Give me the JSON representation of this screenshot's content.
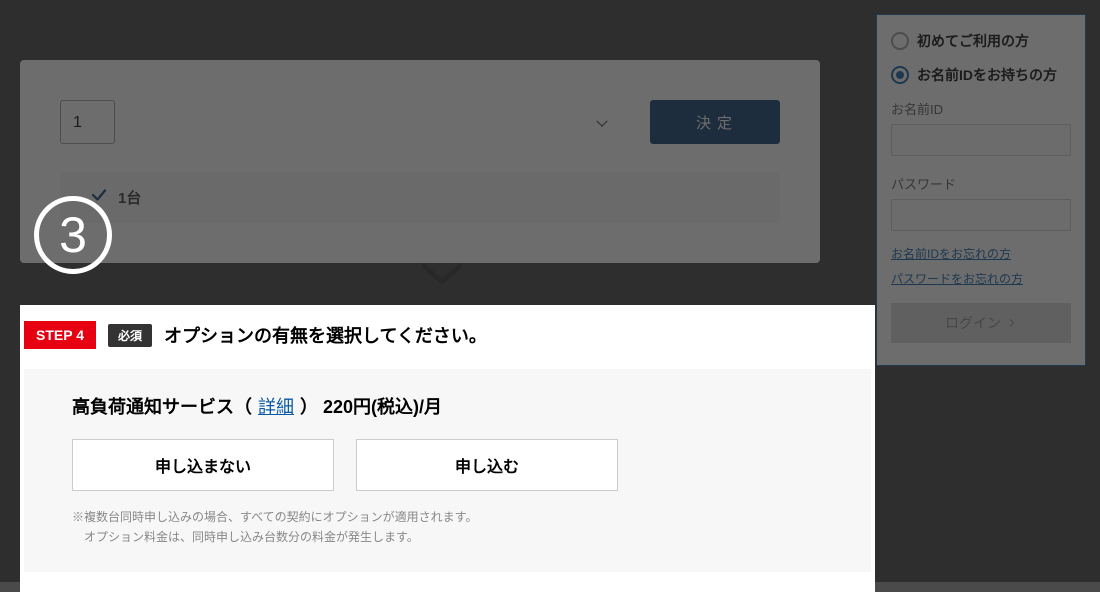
{
  "main": {
    "qty_value": "1",
    "decide_label": "決定",
    "qty_summary": "1台"
  },
  "chevron_name": "chevron-down-icon",
  "circled_num": "3",
  "login": {
    "radio_new": "初めてご利用の方",
    "radio_existing": "お名前IDをお持ちの方",
    "id_label": "お名前ID",
    "pw_label": "パスワード",
    "forgot_id": "お名前IDをお忘れの方",
    "forgot_pw": "パスワードをお忘れの方",
    "login_label": "ログイン"
  },
  "step4": {
    "badge": "STEP 4",
    "required": "必須",
    "title": "オプションの有無を選択してください。",
    "service_name": "高負荷通知サービス（",
    "detail": "詳細",
    "service_tail": "） 220円(税込)/月",
    "btn_no": "申し込まない",
    "btn_yes": "申し込む",
    "note_line1": "※複数台同時申し込みの場合、すべての契約にオプションが適用されます。",
    "note_line2": "　オプション料金は、同時申し込み台数分の料金が発生します。"
  }
}
